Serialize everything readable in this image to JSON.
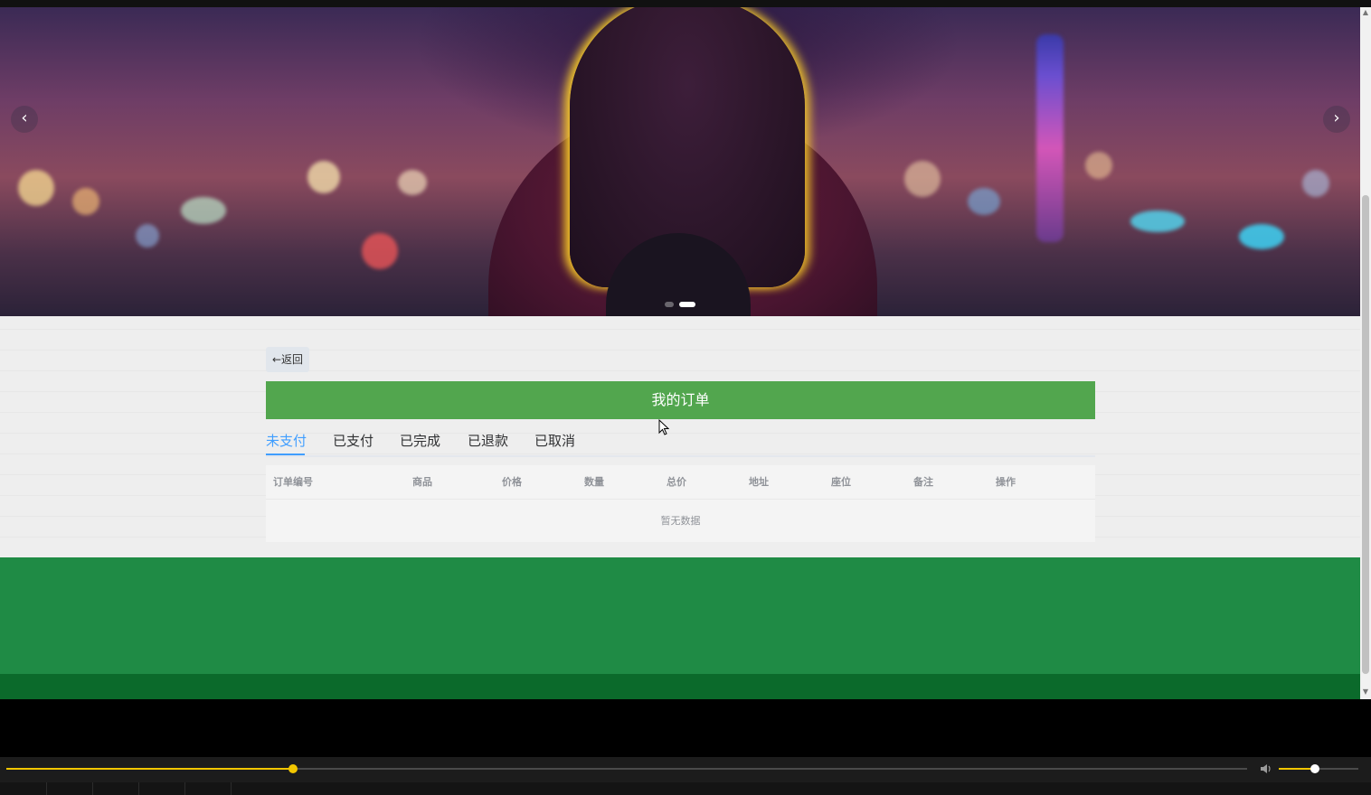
{
  "banner": {
    "prev_icon": "chevron-left-icon",
    "next_icon": "chevron-right-icon",
    "prev_label": "‹",
    "next_label": "›",
    "slide_count": 2,
    "active_slide": 2
  },
  "back_button": {
    "label": "←返回"
  },
  "page_title": "我的订单",
  "tabs": [
    {
      "label": "未支付",
      "active": true
    },
    {
      "label": "已支付",
      "active": false
    },
    {
      "label": "已完成",
      "active": false
    },
    {
      "label": "已退款",
      "active": false
    },
    {
      "label": "已取消",
      "active": false
    }
  ],
  "table": {
    "columns": [
      "订单编号",
      "商品",
      "价格",
      "数量",
      "总价",
      "地址",
      "座位",
      "备注",
      "操作"
    ],
    "rows": [],
    "empty_text": "暂无数据"
  },
  "player": {
    "progress": 0.231,
    "volume": 0.45,
    "accent_color": "#f2c600",
    "volume_icon": "speaker-icon"
  },
  "colors": {
    "title_bar": "#52a64e",
    "active_tab": "#409eff",
    "footer": "#1f8b45",
    "footer_bottom": "#0b6a2b"
  }
}
